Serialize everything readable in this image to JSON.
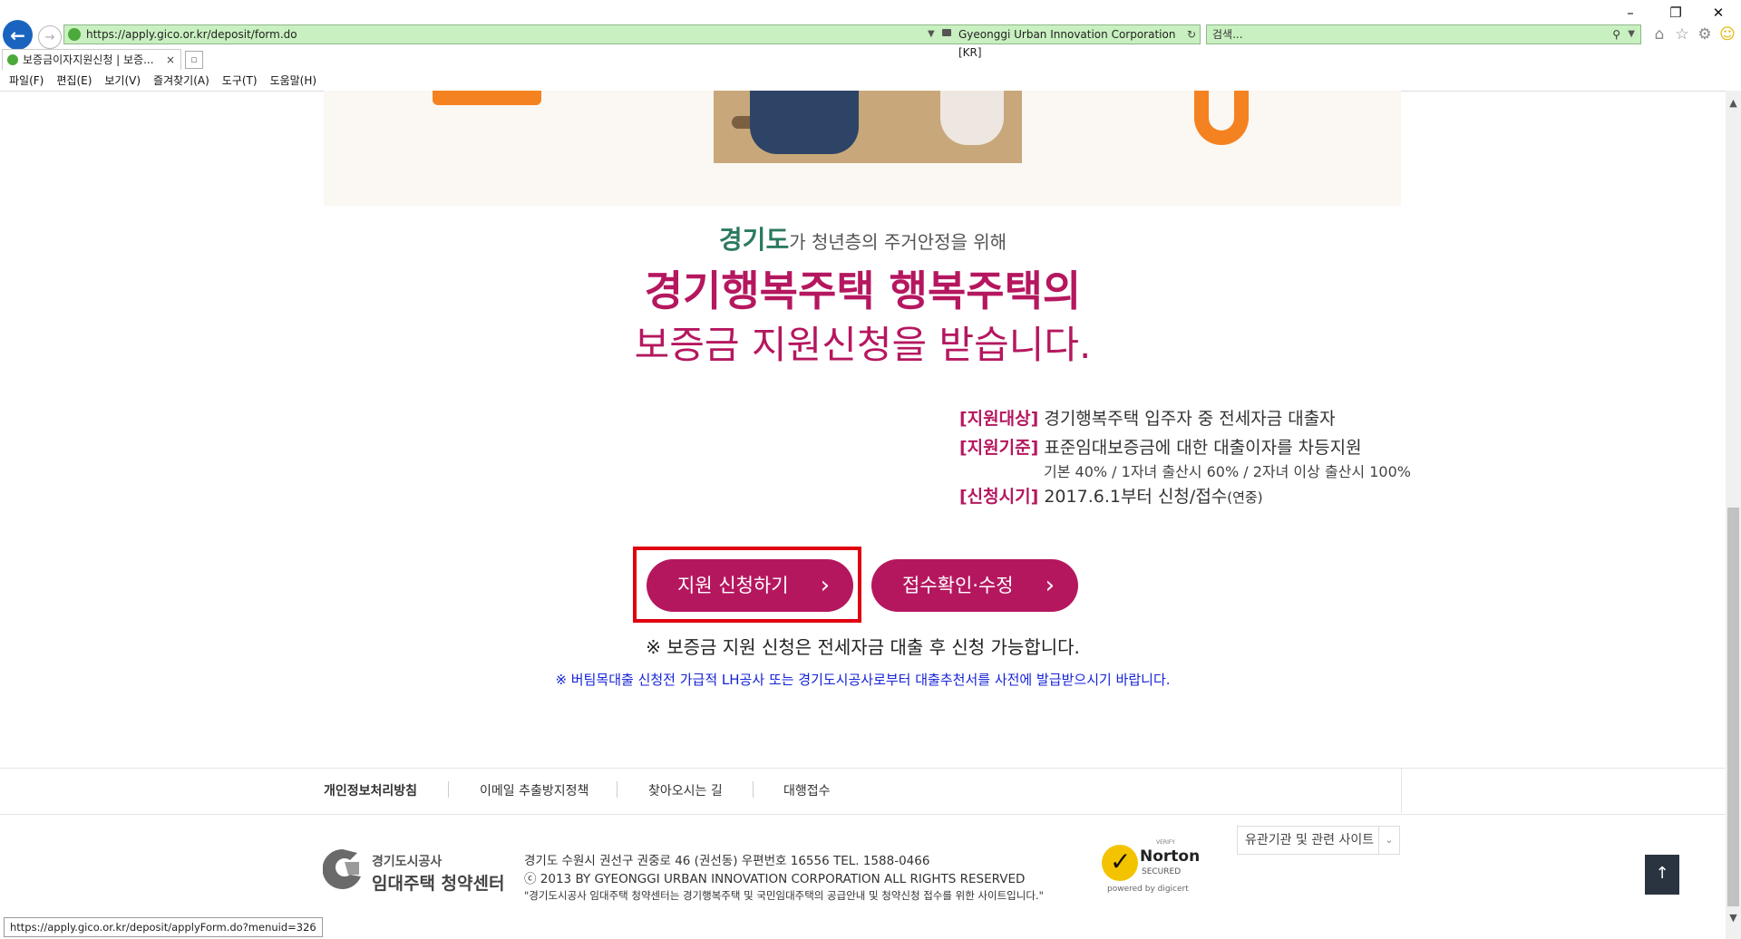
{
  "browser": {
    "url": "https://apply.gico.or.kr/deposit/form.do",
    "site_identity": "Gyeonggi Urban Innovation Corporation [KR]",
    "search_placeholder": "검색...",
    "tab_title": "보증금이자지원신청 | 보증...",
    "tab_close": "×",
    "menu": [
      "파일(F)",
      "편집(E)",
      "보기(V)",
      "즐겨찾기(A)",
      "도구(T)",
      "도움말(H)"
    ],
    "status_url": "https://apply.gico.or.kr/deposit/applyForm.do?menuid=326"
  },
  "intro": {
    "brand": "경기도",
    "text": "가 청년층의 주거안정을 위해",
    "headline": "경기행복주택 행복주택의",
    "subline": "보증금 지원신청을 받습니다."
  },
  "info": {
    "target_label": "[지원대상]",
    "target_text": "경기행복주택 입주자 중 전세자금 대출자",
    "criteria_label": "[지원기준]",
    "criteria_text": "표준임대보증금에 대한 대출이자를 차등지원",
    "criteria_note": "기본 40% / 1자녀 출산시 60% / 2자녀 이상 출산시 100%",
    "period_label": "[신청시기]",
    "period_text": "2017.6.1부터 신청/접수",
    "period_note": "(연중)"
  },
  "buttons": {
    "apply": "지원 신청하기",
    "check": "접수확인·수정",
    "chevron": "›"
  },
  "notices": {
    "main": "※ 보증금 지원 신청은 전세자금 대출 후 신청 가능합니다.",
    "blue": "※ 버팀목대출 신청전 가급적 LH공사 또는 경기도시공사로부터 대출추천서를 사전에 발급받으시기 바랍니다."
  },
  "footer": {
    "links": [
      "개인정보처리방침",
      "이메일 추출방지정책",
      "찾아오시는 길",
      "대행접수"
    ],
    "logo_line1": "경기도시공사",
    "logo_line2": "임대주택 청약센터",
    "address": "경기도 수원시 권선구 권중로 46 (권선동) 우편번호 16556 TEL. 1588-0466",
    "copyright": "ⓒ 2013 BY GYEONGGI URBAN INNOVATION CORPORATION ALL RIGHTS RESERVED",
    "description": "\"경기도시공사 임대주택 청약센터는 경기행복주택 및 국민임대주택의 공급안내 및 청약신청 접수를 위한 사이트입니다.\"",
    "norton_verify": "VERIFY",
    "norton_brand": "Norton",
    "norton_secured": "SECURED",
    "norton_powered": "powered by digicert",
    "related_sites": "유관기관 및 관련 사이트",
    "to_top": "↑"
  },
  "colors": {
    "accent": "#b5175f",
    "brand_green": "#2c7a60",
    "notice_blue": "#1522d6",
    "highlight_red": "#e00010"
  }
}
